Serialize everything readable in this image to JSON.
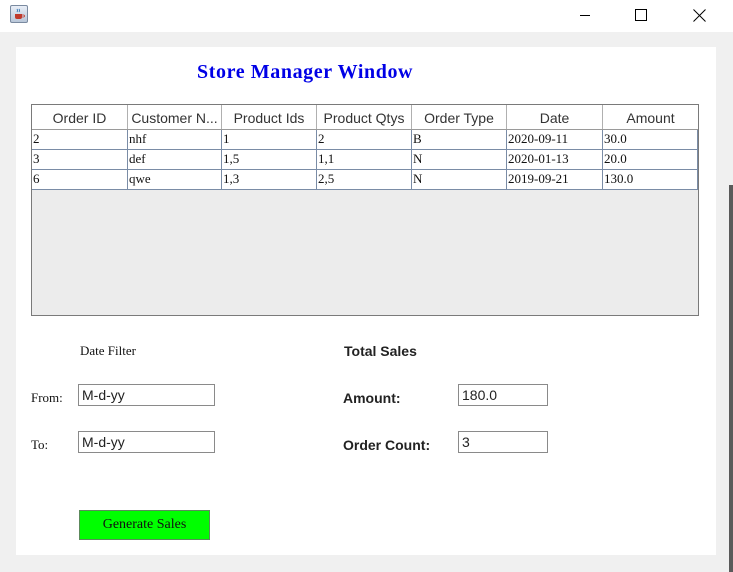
{
  "window": {
    "title_icon": "java-cup-icon",
    "controls": {
      "minimize": "minimize-icon",
      "maximize": "maximize-icon",
      "close": "close-icon"
    }
  },
  "page_title": "Store Manager Window",
  "orders_table": {
    "columns": [
      "Order ID",
      "Customer N...",
      "Product Ids",
      "Product Qtys",
      "Order Type",
      "Date",
      "Amount"
    ],
    "rows": [
      [
        "2",
        "nhf",
        "1",
        "2",
        "B",
        "2020-09-11",
        "30.0"
      ],
      [
        "3",
        "def",
        "1,5",
        "1,1",
        "N",
        "2020-01-13",
        "20.0"
      ],
      [
        "6",
        "qwe",
        "1,3",
        "2,5",
        "N",
        "2019-09-21",
        "130.0"
      ]
    ]
  },
  "date_filter": {
    "heading": "Date Filter",
    "from_label": "From:",
    "from_value": "M-d-yy",
    "to_label": "To:",
    "to_value": "M-d-yy"
  },
  "total_sales": {
    "heading": "Total Sales",
    "amount_label": "Amount:",
    "amount_value": "180.0",
    "count_label": "Order Count:",
    "count_value": "3"
  },
  "generate_button_label": "Generate Sales",
  "colors": {
    "title": "#0000e6",
    "button": "#00ff00"
  }
}
